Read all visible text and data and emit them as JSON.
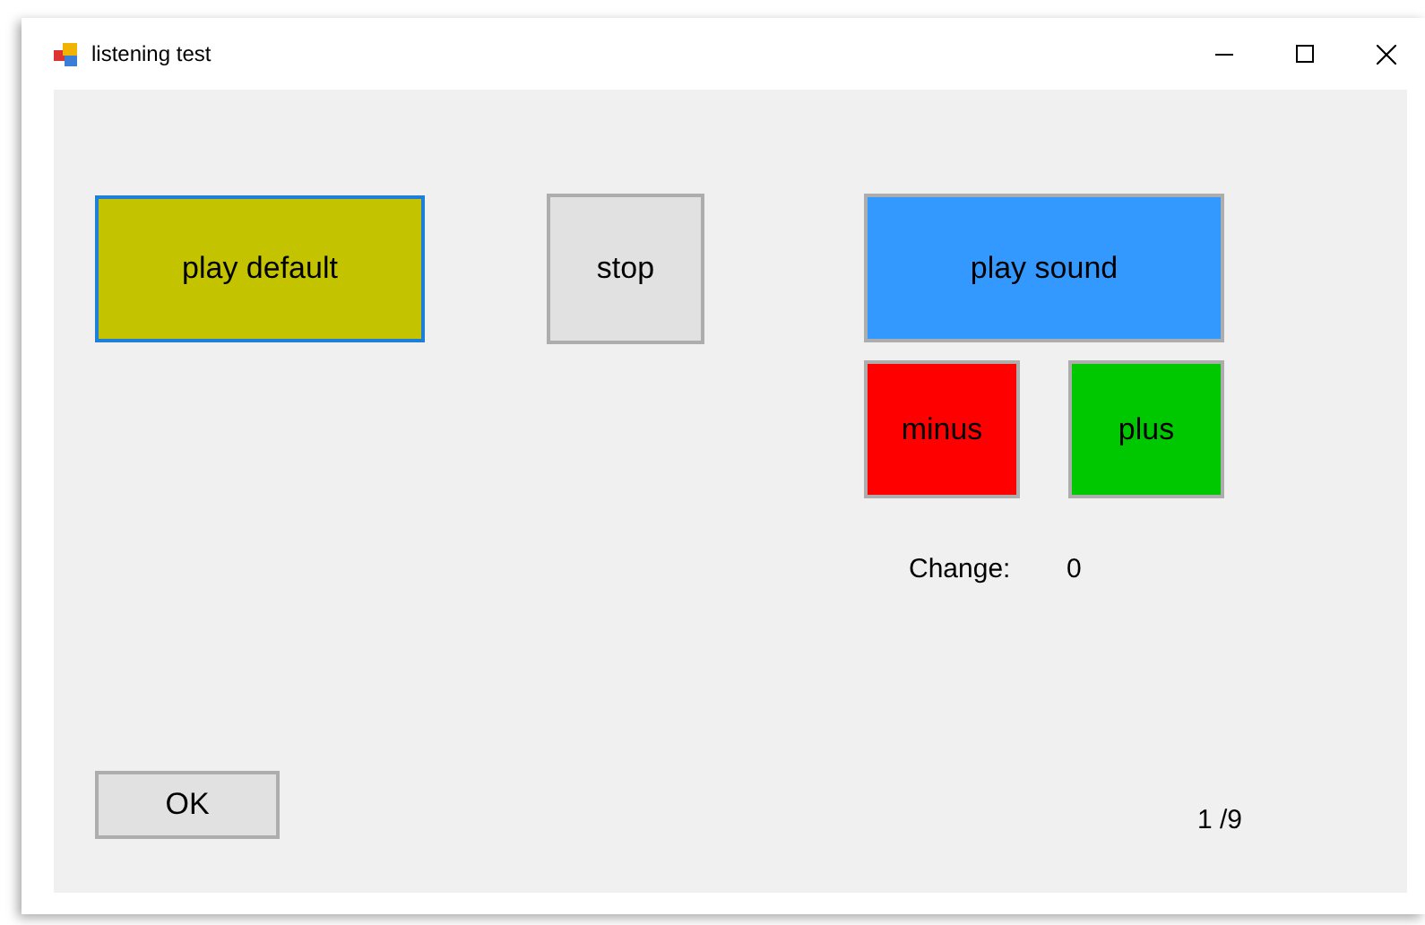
{
  "window": {
    "title": "listening test"
  },
  "buttons": [
    {
      "label": "play default",
      "color": "#c3c300",
      "focused": true
    },
    {
      "label": "stop",
      "color": "#e1e1e1",
      "focused": false
    },
    {
      "label": "play sound",
      "color": "#3399ff",
      "focused": false
    },
    {
      "label": "minus",
      "color": "#ff0000",
      "focused": false
    },
    {
      "label": "plus",
      "color": "#00c800",
      "focused": false
    },
    {
      "label": "OK",
      "color": "#e1e1e1",
      "focused": false
    }
  ],
  "change": {
    "label": "Change:",
    "value": "0"
  },
  "progress": "1 /9"
}
